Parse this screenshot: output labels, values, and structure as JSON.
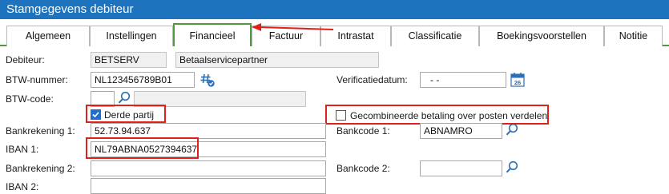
{
  "window": {
    "title": "Stamgegevens debiteur"
  },
  "tabs": [
    {
      "label": "Algemeen",
      "active": false
    },
    {
      "label": "Instellingen",
      "active": false
    },
    {
      "label": "Financieel",
      "active": true
    },
    {
      "label": "Factuur",
      "active": false
    },
    {
      "label": "Intrastat",
      "active": false
    },
    {
      "label": "Classificatie",
      "active": false
    },
    {
      "label": "Boekingsvoorstellen",
      "active": false
    },
    {
      "label": "Notitie",
      "active": false
    }
  ],
  "form": {
    "debiteur_label": "Debiteur:",
    "debiteur_code": "BETSERV",
    "debiteur_name": "Betaalservicepartner",
    "btw_nummer_label": "BTW-nummer:",
    "btw_nummer_value": "NL123456789B01",
    "verificatiedatum_label": "Verificatiedatum:",
    "verificatiedatum_value": "-  -",
    "btw_code_label": "BTW-code:",
    "btw_code_value": "",
    "btw_code_description": "",
    "derde_partij_label": "Derde partij",
    "derde_partij_checked": true,
    "gecombineerde_label": "Gecombineerde betaling over posten verdelen",
    "gecombineerde_checked": false,
    "bankrekening1_label": "Bankrekening 1:",
    "bankrekening1_value": "52.73.94.637",
    "bankcode1_label": "Bankcode 1:",
    "bankcode1_value": "ABNAMRO",
    "iban1_label": "IBAN 1:",
    "iban1_value": "NL79ABNA0527394637",
    "bankrekening2_label": "Bankrekening 2:",
    "bankrekening2_value": "",
    "bankcode2_label": "Bankcode 2:",
    "bankcode2_value": "",
    "iban2_label": "IBAN 2:",
    "iban2_value": ""
  },
  "icons": {
    "btw_verify": "hash-check-icon",
    "calendar": "calendar-icon",
    "btw_code_lookup": "search-icon",
    "bankcode1_lookup": "search-icon",
    "bankcode2_lookup": "search-icon"
  },
  "colors": {
    "titlebar": "#1e73be",
    "active_tab_border": "#4e9a3c",
    "highlight": "#e0201b",
    "checkbox_checked": "#1e6fd0"
  }
}
